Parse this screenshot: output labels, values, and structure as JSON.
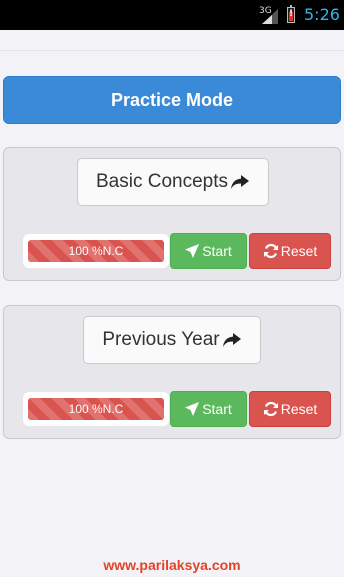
{
  "status_bar": {
    "network_label": "3G",
    "time": "5:26",
    "time_color": "#33b5e5"
  },
  "header": {
    "mode_label": "Practice Mode",
    "mode_color": "#3a8ad8"
  },
  "topics": [
    {
      "name": "Basic Concepts",
      "progress_label": "100 %N.C",
      "progress_fraction": 1.0,
      "start_label": "Start",
      "reset_label": "Reset"
    },
    {
      "name": "Previous Year",
      "progress_label": "100 %N.C",
      "progress_fraction": 1.0,
      "start_label": "Start",
      "reset_label": "Reset"
    }
  ],
  "colors": {
    "start": "#5cb85c",
    "reset": "#d9534f",
    "footer": "#e2442a"
  },
  "icons": {
    "topic_arrow": "share-arrow-icon",
    "start": "send-arrow-icon",
    "reset": "refresh-icon",
    "battery": "battery-alert-icon",
    "signal": "signal-icon"
  },
  "footer": {
    "url": "www.parilaksya.com"
  }
}
